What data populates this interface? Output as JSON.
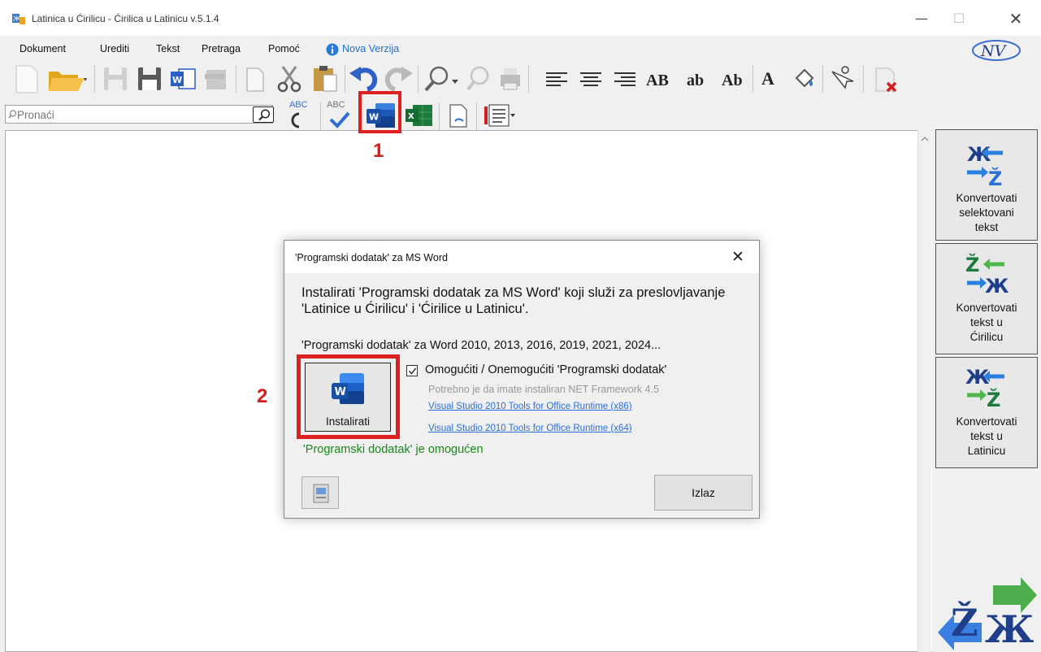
{
  "window": {
    "title": "Latinica u Ćirilicu - Ćirilica u Latinicu v.5.1.4",
    "minimize": "—",
    "maximize": "☐",
    "close": "✕"
  },
  "menu": {
    "items": [
      "Dokument",
      "Urediti",
      "Tekst",
      "Pretraga",
      "Pomoć"
    ],
    "update_link": "Nova Verzija"
  },
  "toolbar1": {
    "icons": [
      "new-document-icon",
      "open-folder-icon",
      "save-icon",
      "save-as-icon",
      "word-export-icon",
      "archive-icon",
      "copy-icon",
      "cut-icon",
      "paste-icon",
      "undo-icon",
      "redo-icon",
      "find-icon",
      "find-disabled-icon",
      "print-icon",
      "align-left-icon",
      "align-center-icon",
      "align-right-icon",
      "uppercase-icon",
      "lowercase-icon",
      "titlecase-icon",
      "font-color-icon",
      "fill-color-icon",
      "select-icon",
      "clear-icon"
    ],
    "case_labels": {
      "upper": "AB",
      "lower": "ab",
      "title": "Ab",
      "font_color": "A"
    }
  },
  "toolbar2": {
    "search_placeholder": "Pronaći",
    "spell_label": "ABC",
    "spell2_label": "ABC"
  },
  "sidebar": {
    "buttons": [
      {
        "label": "Konvertovati selektovani tekst",
        "lines": [
          "Konvertovati",
          "selektovani",
          "tekst"
        ]
      },
      {
        "label": "Konvertovati tekst u Ćirilicu",
        "lines": [
          "Konvertovati",
          "tekst u",
          "Ćirilicu"
        ]
      },
      {
        "label": "Konvertovati tekst u Latinicu",
        "lines": [
          "Konvertovati",
          "tekst u",
          "Latinicu"
        ]
      }
    ]
  },
  "dialog": {
    "title": "'Programski dodatak' za MS Word",
    "description": "Instalirati 'Programski dodatak za MS Word' koji služi za preslovljavanje 'Latinice u Ćirilicu' i 'Ćirilice u Latinicu'.",
    "versions": "'Programski dodatak' za Word 2010, 2013, 2016, 2019, 2021, 2024...",
    "install_label": "Instalirati",
    "enable_checkbox_label": "Omogućiti / Onemogućiti 'Programski dodatak'",
    "enable_checked": true,
    "net_note": "Potrebno je da imate instaliran NET Framework 4.5",
    "link_x86": "Visual Studio 2010 Tools for Office Runtime (x86)",
    "link_x64": "Visual Studio 2010 Tools for Office Runtime (x64)",
    "status": "'Programski dodatak' je omogućen",
    "exit_label": "Izlaz"
  },
  "annotations": {
    "step1": "1",
    "step2": "2",
    "color": "#e02020"
  },
  "colors": {
    "word_blue": "#2b5fc0",
    "excel_green": "#1e7a3c",
    "status_green": "#168a16",
    "link_blue": "#2b6fd6"
  }
}
